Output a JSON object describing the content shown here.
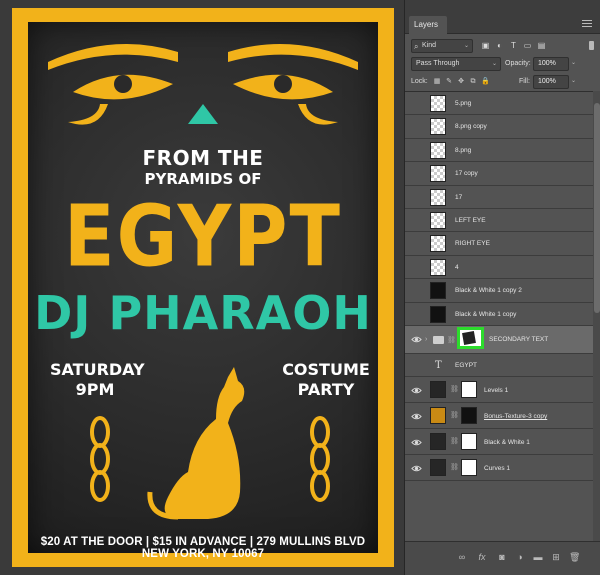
{
  "poster": {
    "line1": "FROM THE",
    "line2": "PYRAMIDS OF",
    "title": "EGYPT",
    "subtitle": "DJ PHARAOH",
    "day": "SATURDAY",
    "time": "9PM",
    "costume1": "COSTUME",
    "costume2": "PARTY",
    "footer": "$20 AT THE DOOR | $15 IN ADVANCE | 279 MULLINS BLVD NEW YORK, NY 10067",
    "colors": {
      "gold": "#f2b21a",
      "teal": "#2fc7a6",
      "dark": "#2a2a2a"
    }
  },
  "panel": {
    "tab": "Layers",
    "kind": "Kind",
    "blend_mode": "Pass Through",
    "opacity_label": "Opacity:",
    "opacity_value": "100%",
    "lock_label": "Lock:",
    "fill_label": "Fill:",
    "fill_value": "100%",
    "layers": [
      {
        "name": "5.png"
      },
      {
        "name": "8.png copy"
      },
      {
        "name": "8.png"
      },
      {
        "name": "17 copy"
      },
      {
        "name": "17"
      },
      {
        "name": "LEFT EYE"
      },
      {
        "name": "RIGHT EYE"
      },
      {
        "name": "4"
      },
      {
        "name": "Black & White 1 copy 2"
      },
      {
        "name": "Black & White 1 copy"
      },
      {
        "name": "SECONDARY TEXT"
      },
      {
        "name": "EGYPT"
      },
      {
        "name": "Levels 1"
      },
      {
        "name": "Bonus-Texture-3 copy"
      },
      {
        "name": "Black & White 1"
      },
      {
        "name": "Curves 1"
      }
    ],
    "accent": "#2cdc2c"
  }
}
